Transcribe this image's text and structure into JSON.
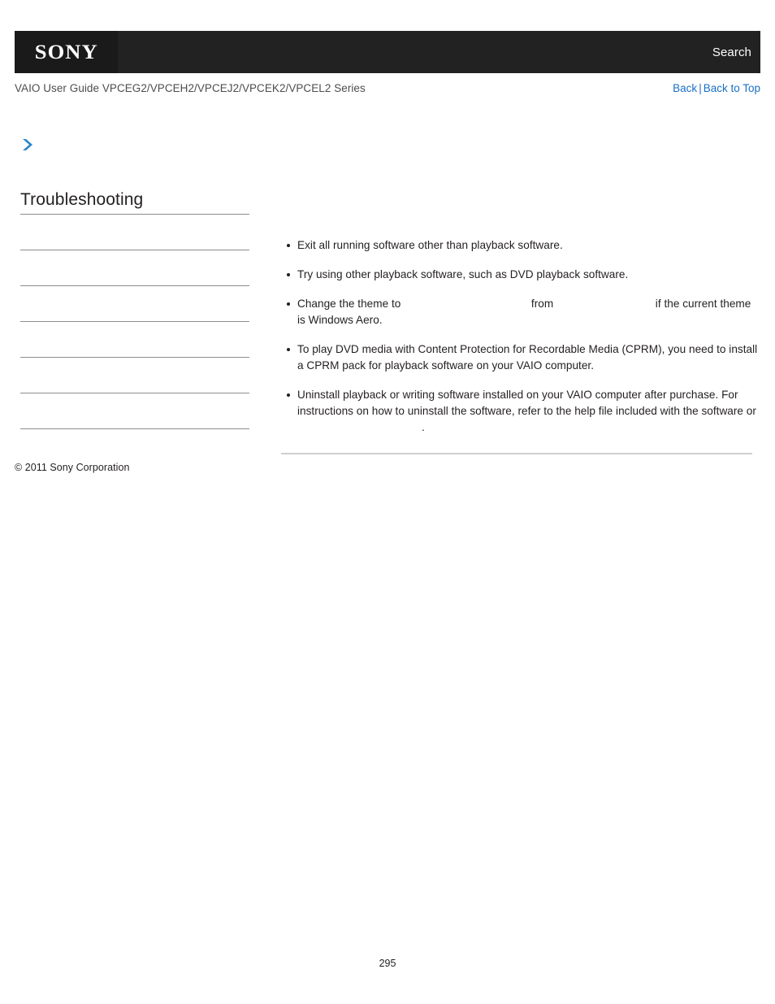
{
  "header": {
    "logo_text": "SONY",
    "search_label": "Search",
    "brand_bar_color": "#222222",
    "logo_block_color": "#1a1a1a"
  },
  "guide_bar": {
    "title": "VAIO User Guide VPCEG2/VPCEH2/VPCEJ2/VPCEK2/VPCEL2 Series",
    "back_label": "Back",
    "separator": "|",
    "back_to_top_label": "Back to Top",
    "link_color": "#1a6fc4"
  },
  "sidebar": {
    "chevron_icon": "chevron-right-icon",
    "chevron_color": "#2e86c8",
    "title": "Troubleshooting",
    "items": [
      {
        "label": ""
      },
      {
        "label": ""
      },
      {
        "label": ""
      },
      {
        "label": ""
      },
      {
        "label": ""
      },
      {
        "label": ""
      }
    ]
  },
  "footer": {
    "copyright": "© 2011 Sony Corporation"
  },
  "content": {
    "bullets": [
      {
        "segments": [
          {
            "type": "text",
            "value": "Exit all running software other than playback software."
          }
        ]
      },
      {
        "segments": [
          {
            "type": "text",
            "value": "Try using other playback software, such as DVD playback software."
          }
        ]
      },
      {
        "segments": [
          {
            "type": "text",
            "value": "Change the theme to"
          },
          {
            "type": "gap",
            "value": ""
          },
          {
            "type": "text",
            "value": "from"
          },
          {
            "type": "gap",
            "value": ""
          },
          {
            "type": "text",
            "value": "if the current theme is Windows Aero."
          }
        ]
      },
      {
        "segments": [
          {
            "type": "text",
            "value": "To play DVD media with Content Protection for Recordable Media (CPRM), you need to install a CPRM pack for playback software on your VAIO computer."
          }
        ]
      },
      {
        "segments": [
          {
            "type": "text",
            "value": "Uninstall playback or writing software installed on your VAIO computer after purchase. For instructions on how to uninstall the software, refer to the help file included with the software or"
          },
          {
            "type": "gap",
            "value": ""
          },
          {
            "type": "text",
            "value": "."
          }
        ]
      }
    ]
  },
  "page": {
    "number": "295"
  }
}
